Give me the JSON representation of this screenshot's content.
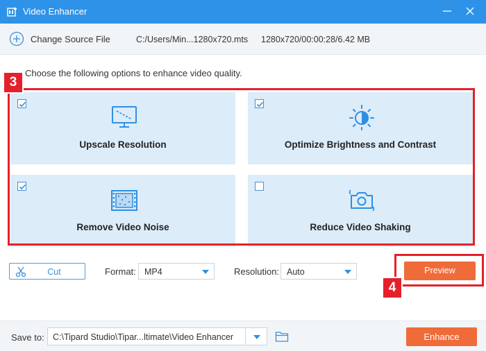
{
  "window": {
    "title": "Video Enhancer"
  },
  "source": {
    "change_label": "Change Source File",
    "path": "C:/Users/Min...1280x720.mts",
    "info": "1280x720/00:00:28/6.42 MB"
  },
  "instruction": "Choose the following options to enhance video quality.",
  "options": [
    {
      "label": "Upscale Resolution",
      "checked": true,
      "icon": "monitor-icon"
    },
    {
      "label": "Optimize Brightness and Contrast",
      "checked": true,
      "icon": "brightness-icon"
    },
    {
      "label": "Remove Video Noise",
      "checked": true,
      "icon": "film-icon"
    },
    {
      "label": "Reduce Video Shaking",
      "checked": false,
      "icon": "camera-shake-icon"
    }
  ],
  "controls": {
    "cut_label": "Cut",
    "format_label": "Format:",
    "format_value": "MP4",
    "resolution_label": "Resolution:",
    "resolution_value": "Auto",
    "preview_label": "Preview"
  },
  "footer": {
    "save_label": "Save to:",
    "save_path": "C:\\Tipard Studio\\Tipar...ltimate\\Video Enhancer",
    "enhance_label": "Enhance"
  },
  "badges": {
    "options_step": "3",
    "preview_step": "4"
  },
  "colors": {
    "titlebar": "#2e93e8",
    "card": "#dcecf9",
    "highlight": "#e5202a",
    "accent_button": "#f06b3a"
  }
}
